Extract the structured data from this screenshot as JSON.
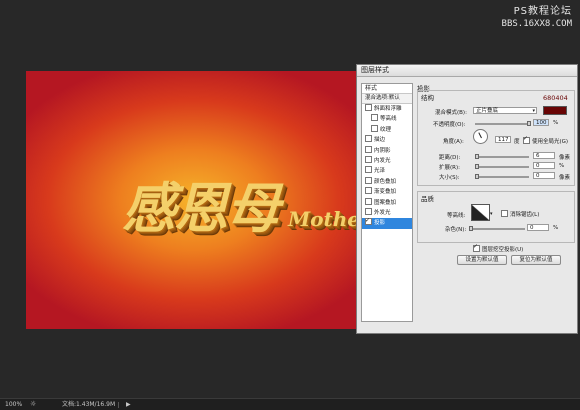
{
  "watermark": {
    "line1": "PS教程论坛",
    "line2": "BBS.16XX8.COM"
  },
  "canvas": {
    "title_text": "感恩母",
    "sub_text": "Mothe"
  },
  "dialog": {
    "title": "图层样式",
    "styles_header": "样式",
    "blend_options": "混合选项:默认",
    "style_items": [
      {
        "label": "斜面和浮雕",
        "checked": false,
        "indent": false
      },
      {
        "label": "等高线",
        "checked": false,
        "indent": true
      },
      {
        "label": "纹理",
        "checked": false,
        "indent": true
      },
      {
        "label": "描边",
        "checked": false,
        "indent": false
      },
      {
        "label": "内阴影",
        "checked": false,
        "indent": false
      },
      {
        "label": "内发光",
        "checked": false,
        "indent": false
      },
      {
        "label": "光泽",
        "checked": false,
        "indent": false
      },
      {
        "label": "颜色叠加",
        "checked": false,
        "indent": false
      },
      {
        "label": "渐变叠加",
        "checked": false,
        "indent": false
      },
      {
        "label": "图案叠加",
        "checked": false,
        "indent": false
      },
      {
        "label": "外发光",
        "checked": false,
        "indent": false
      },
      {
        "label": "投影",
        "checked": true,
        "indent": false,
        "active": true
      }
    ],
    "section_title": "投影",
    "structure_title": "结构",
    "color_hex": "680404",
    "blend_mode_label": "混合模式(B):",
    "blend_mode_value": "正片叠底",
    "opacity_label": "不透明度(O):",
    "opacity_value": "100",
    "angle_label": "角度(A):",
    "angle_value": "117",
    "angle_unit": "度",
    "global_light_label": "使用全局光(G)",
    "distance_label": "距离(D):",
    "distance_value": "6",
    "spread_label": "扩展(R):",
    "spread_value": "0",
    "size_label": "大小(S):",
    "size_value": "0",
    "px_unit": "像素",
    "pct_unit": "%",
    "quality_title": "品质",
    "contour_label": "等高线:",
    "antialias_label": "消除锯齿(L)",
    "noise_label": "杂色(N):",
    "noise_value": "0",
    "knockout_label": "图层挖空投影(U)",
    "make_default": "设置为默认值",
    "reset_default": "复位为默认值",
    "shadow_color": "#680404"
  },
  "status": {
    "zoom": "100%",
    "doc": "文档:1.43M/16.9M"
  }
}
